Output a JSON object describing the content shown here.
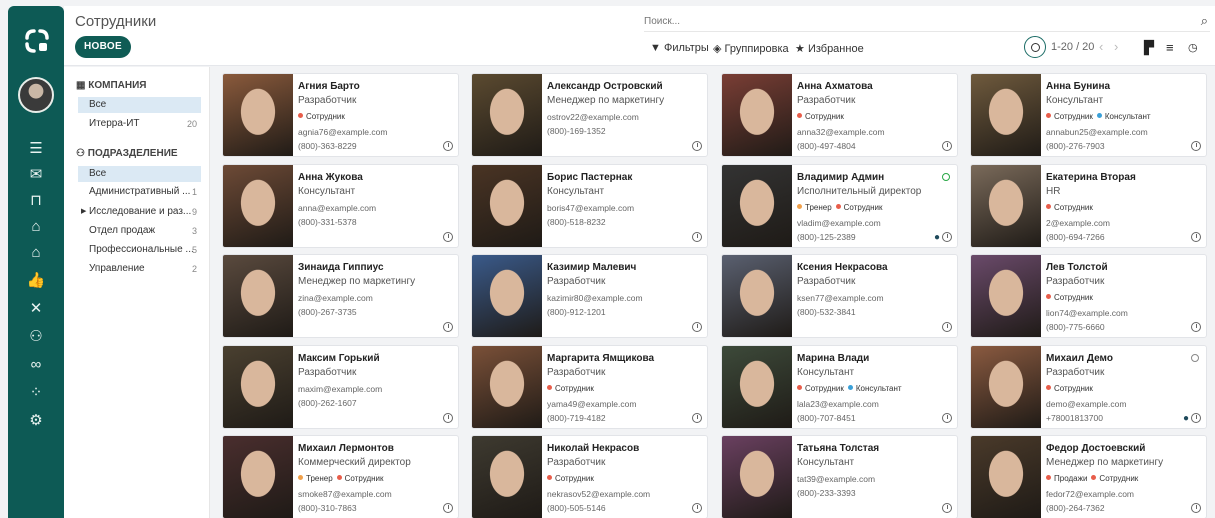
{
  "header": {
    "title": "Сотрудники",
    "new_button": "НОВОЕ",
    "search_placeholder": "Поиск...",
    "filters": "Фильтры",
    "group": "Группировка",
    "favorites": "Избранное",
    "pager": "1-20 / 20"
  },
  "sidebar": {
    "company_title": "КОМПАНИЯ",
    "company_items": [
      {
        "label": "Все",
        "count": ""
      },
      {
        "label": "Итерра-ИТ",
        "count": "20"
      }
    ],
    "dept_title": "ПОДРАЗДЕЛЕНИЕ",
    "dept_items": [
      {
        "label": "Все",
        "count": ""
      },
      {
        "label": "Административный ...",
        "count": "1"
      },
      {
        "label": "Исследование и раз...",
        "count": "9"
      },
      {
        "label": "Отдел продаж",
        "count": "3"
      },
      {
        "label": "Профессиональные ...",
        "count": "5"
      },
      {
        "label": "Управление",
        "count": "2"
      }
    ]
  },
  "tag_colors": {
    "employee": "#e85d4a",
    "consultant": "#3aa0d8",
    "trainer": "#f0a04a",
    "sales": "#e85d4a"
  },
  "employees": [
    {
      "name": "Агния Барто",
      "job": "Разработчик",
      "tags": [
        "Сотрудник"
      ],
      "email": "agnia76@example.com",
      "phone": "(800)-363-8229",
      "photo": "#8a5a3c"
    },
    {
      "name": "Александр Островский",
      "job": "Менеджер по маркетингу",
      "tags": [],
      "email": "ostrov22@example.com",
      "phone": "(800)-169-1352",
      "photo": "#5b4a30"
    },
    {
      "name": "Анна Ахматова",
      "job": "Разработчик",
      "tags": [
        "Сотрудник"
      ],
      "email": "anna32@example.com",
      "phone": "(800)-497-4804",
      "photo": "#7a3e35"
    },
    {
      "name": "Анна Бунина",
      "job": "Консультант",
      "tags": [
        "Сотрудник",
        "Консультант"
      ],
      "email": "annabun25@example.com",
      "phone": "(800)-276-7903",
      "photo": "#6f5a3d"
    },
    {
      "name": "Анна Жукова",
      "job": "Консультант",
      "tags": [],
      "email": "anna@example.com",
      "phone": "(800)-331-5378",
      "photo": "#6d4a36"
    },
    {
      "name": "Борис Пастернак",
      "job": "Консультант",
      "tags": [],
      "email": "boris47@example.com",
      "phone": "(800)-518-8232",
      "photo": "#4a3424"
    },
    {
      "name": "Владимир Админ",
      "job": "Исполнительный директор",
      "tags": [
        "Тренер",
        "Сотрудник"
      ],
      "email": "vladim@example.com",
      "phone": "(800)-125-2389",
      "photo": "#333333",
      "online": true,
      "chat": true
    },
    {
      "name": "Екатерина Вторая",
      "job": "HR",
      "tags": [
        "Сотрудник"
      ],
      "email": "2@example.com",
      "phone": "(800)-694-7266",
      "photo": "#7a6a5a"
    },
    {
      "name": "Зинаида Гиппиус",
      "job": "Менеджер по маркетингу",
      "tags": [],
      "email": "zina@example.com",
      "phone": "(800)-267-3735",
      "photo": "#5a4a3e"
    },
    {
      "name": "Казимир Малевич",
      "job": "Разработчик",
      "tags": [],
      "email": "kazimir80@example.com",
      "phone": "(800)-912-1201",
      "photo": "#3a5a8a"
    },
    {
      "name": "Ксения Некрасова",
      "job": "Разработчик",
      "tags": [],
      "email": "ksen77@example.com",
      "phone": "(800)-532-3841",
      "photo": "#5a6070"
    },
    {
      "name": "Лев Толстой",
      "job": "Разработчик",
      "tags": [
        "Сотрудник"
      ],
      "email": "lion74@example.com",
      "phone": "(800)-775-6660",
      "photo": "#6a4a6a"
    },
    {
      "name": "Максим Горький",
      "job": "Разработчик",
      "tags": [],
      "email": "maxim@example.com",
      "phone": "(800)-262-1607",
      "photo": "#4a4030"
    },
    {
      "name": "Маргарита Ямщикова",
      "job": "Разработчик",
      "tags": [
        "Сотрудник"
      ],
      "email": "yama49@example.com",
      "phone": "(800)-719-4182",
      "photo": "#7a5038"
    },
    {
      "name": "Марина Влади",
      "job": "Консультант",
      "tags": [
        "Сотрудник",
        "Консультант"
      ],
      "email": "lala23@example.com",
      "phone": "(800)-707-8451",
      "photo": "#3d4a3a"
    },
    {
      "name": "Михаил Демо",
      "job": "Разработчик",
      "tags": [
        "Сотрудник"
      ],
      "email": "demo@example.com",
      "phone": "+78001813700",
      "photo": "#8a5a40",
      "away": true,
      "chat": true
    },
    {
      "name": "Михаил Лермонтов",
      "job": "Коммерческий директор",
      "tags": [
        "Тренер",
        "Сотрудник"
      ],
      "email": "smoke87@example.com",
      "phone": "(800)-310-7863",
      "photo": "#4a2e2e"
    },
    {
      "name": "Николай Некрасов",
      "job": "Разработчик",
      "tags": [
        "Сотрудник"
      ],
      "email": "nekrasov52@example.com",
      "phone": "(800)-505-5146",
      "photo": "#3e3a30"
    },
    {
      "name": "Татьяна Толстая",
      "job": "Консультант",
      "tags": [],
      "email": "tat39@example.com",
      "phone": "(800)-233-3393",
      "photo": "#6a4060"
    },
    {
      "name": "Федор Достоевский",
      "job": "Менеджер по маркетингу",
      "tags": [
        "Продажи",
        "Сотрудник"
      ],
      "email": "fedor72@example.com",
      "phone": "(800)-264-7362",
      "photo": "#4a3a2a"
    }
  ]
}
